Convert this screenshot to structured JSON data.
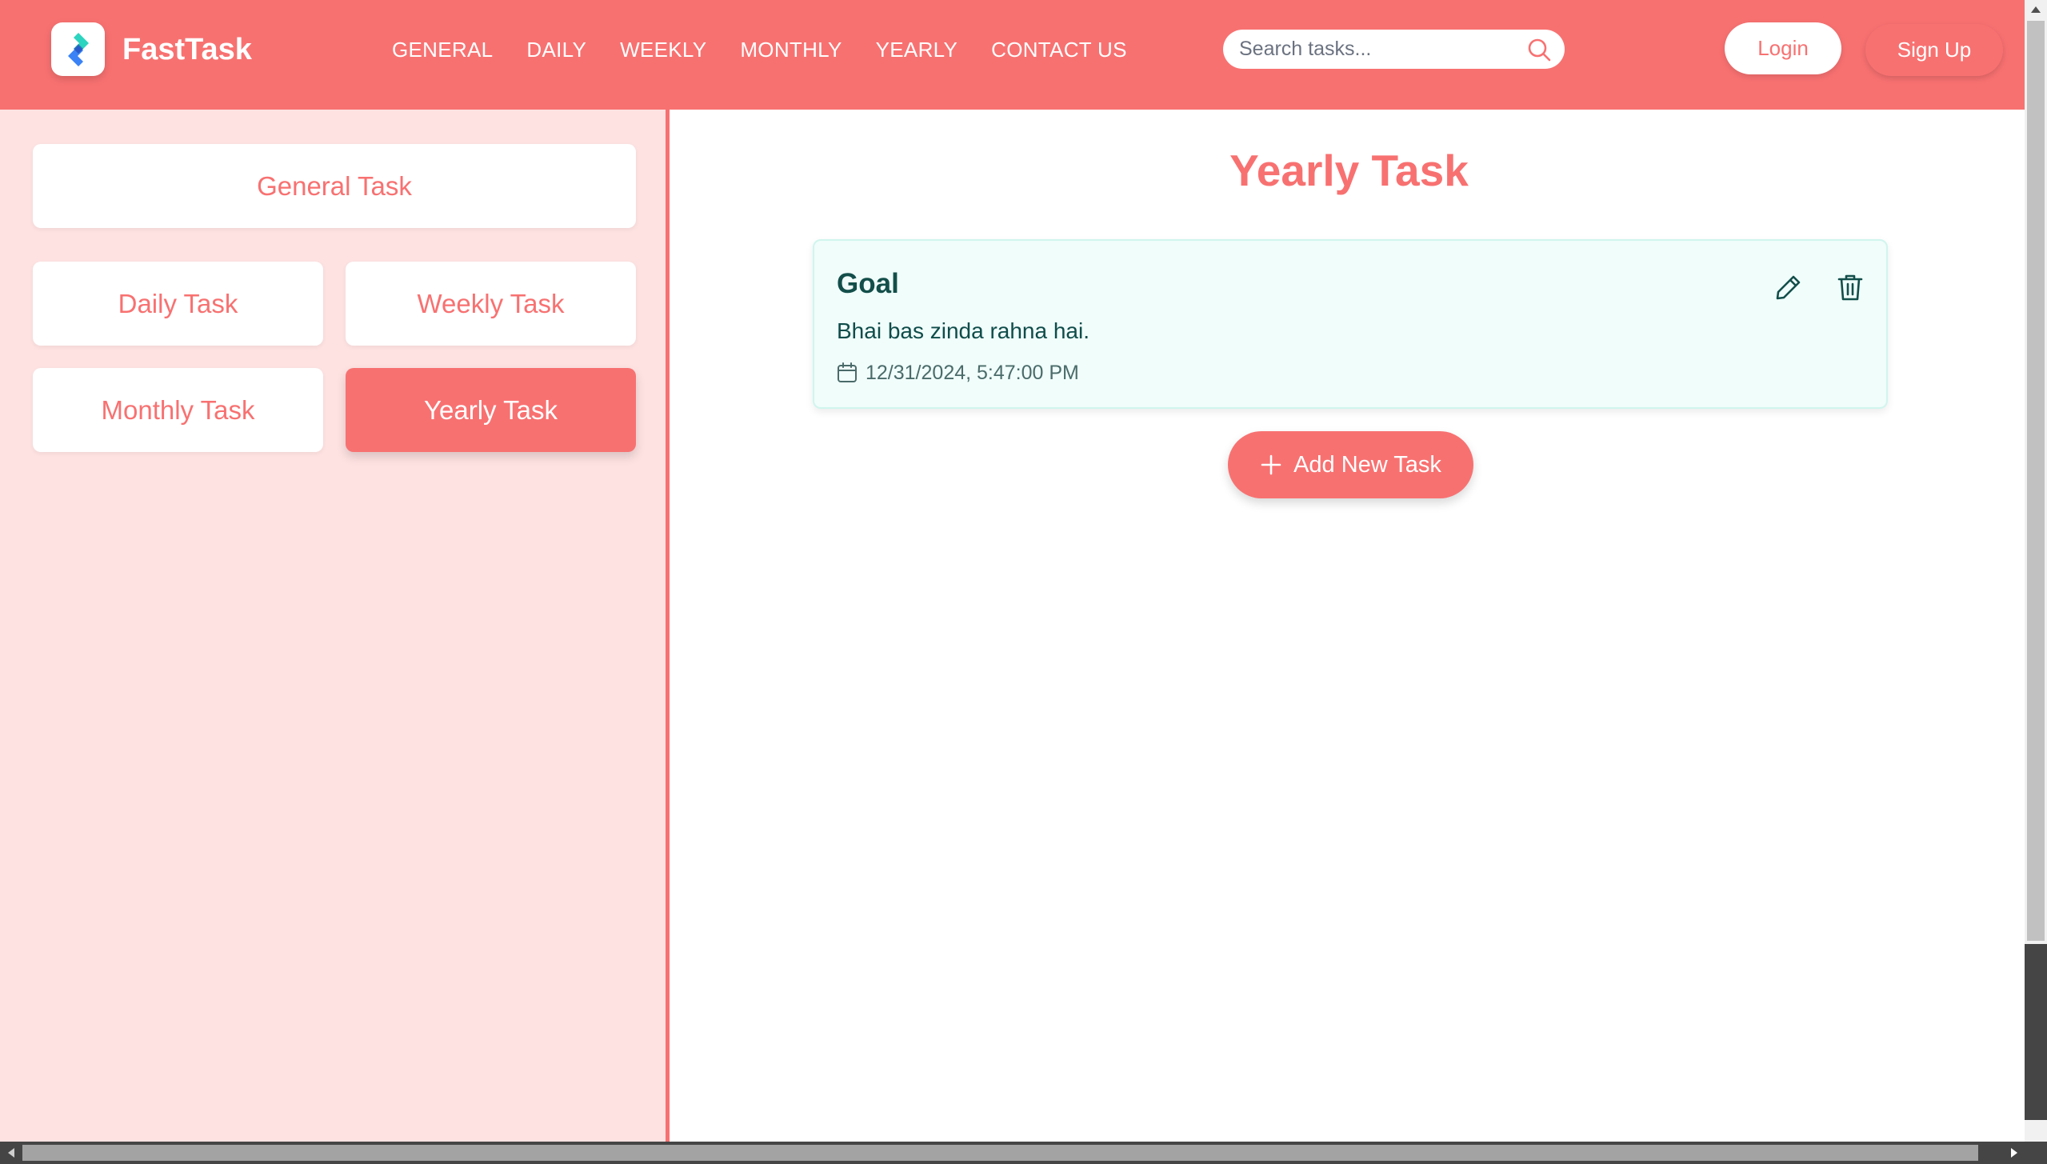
{
  "header": {
    "brand": "FastTask",
    "logo_icon": "fasttask-logo-icon",
    "nav": [
      "GENERAL",
      "DAILY",
      "WEEKLY",
      "MONTHLY",
      "YEARLY",
      "CONTACT US"
    ],
    "search_placeholder": "Search tasks...",
    "login_label": "Login",
    "signup_label": "Sign Up"
  },
  "sidebar": {
    "general": "General Task",
    "daily": "Daily Task",
    "weekly": "Weekly Task",
    "monthly": "Monthly Task",
    "yearly": "Yearly Task",
    "active": "Yearly Task"
  },
  "main": {
    "title": "Yearly Task",
    "tasks": [
      {
        "title": "Goal",
        "description": "Bhai bas zinda rahna hai.",
        "date": "12/31/2024, 5:47:00 PM"
      }
    ],
    "add_button": "Add New Task"
  },
  "colors": {
    "primary": "#f87171",
    "sidebar_bg": "#fee2e2",
    "card_bg": "#f0fdfa",
    "card_text": "#134e4a"
  }
}
